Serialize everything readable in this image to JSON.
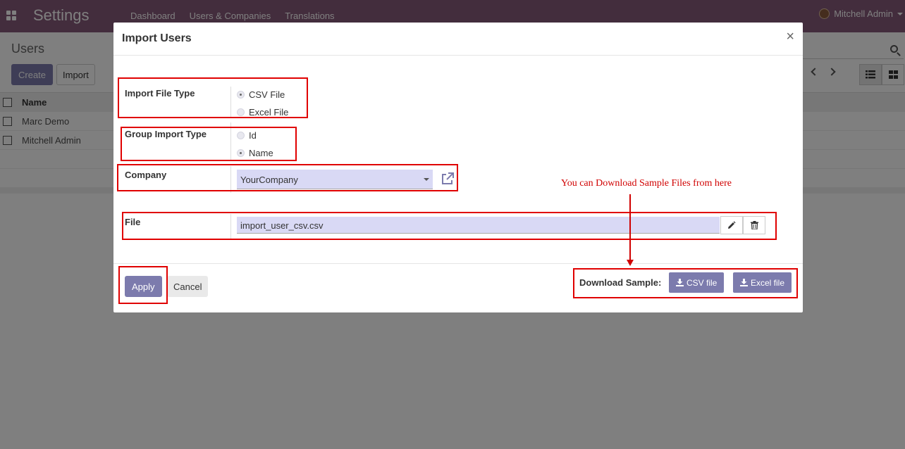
{
  "navbar": {
    "app_title": "Settings",
    "menu": [
      "Dashboard",
      "Users & Companies",
      "Translations"
    ],
    "user_name": "Mitchell Admin"
  },
  "control_panel": {
    "breadcrumb": "Users",
    "create_label": "Create",
    "import_label": "Import"
  },
  "list": {
    "column_name": "Name",
    "rows": [
      "Marc Demo",
      "Mitchell Admin"
    ]
  },
  "modal": {
    "title": "Import Users",
    "close_symbol": "×",
    "import_file_type": {
      "label": "Import File Type",
      "options": [
        "CSV File",
        "Excel File"
      ],
      "selected": "CSV File"
    },
    "group_import_type": {
      "label": "Group Import Type",
      "options": [
        "Id",
        "Name"
      ],
      "selected": "Name"
    },
    "company": {
      "label": "Company",
      "value": "YourCompany"
    },
    "file": {
      "label": "File",
      "value": "import_user_csv.csv"
    },
    "footer": {
      "apply_label": "Apply",
      "cancel_label": "Cancel",
      "download_label": "Download Sample:",
      "csv_file_label": "CSV file",
      "excel_file_label": "Excel file"
    }
  },
  "annotation": {
    "note": "You can Download Sample Files from here"
  },
  "colors": {
    "brand": "#875A7B",
    "primary_button": "#7C7BAD",
    "input_fill": "#d9d9f5",
    "annotation_red": "#e00000"
  }
}
